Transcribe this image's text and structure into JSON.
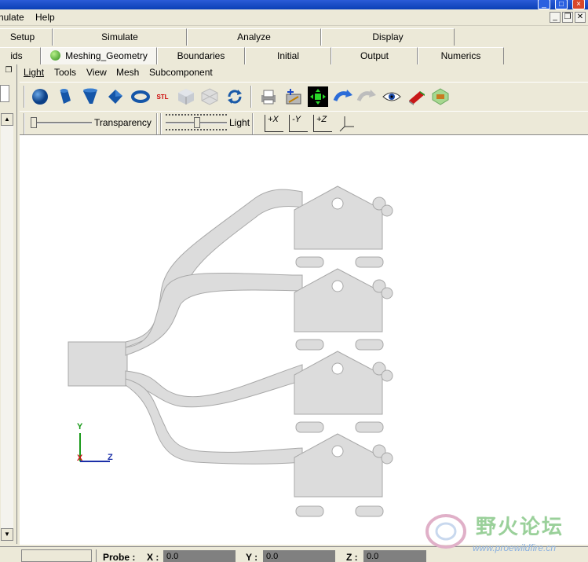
{
  "menubar": {
    "items": [
      "nulate",
      "Help"
    ]
  },
  "tabs_top": [
    "Setup",
    "Simulate",
    "Analyze",
    "Display"
  ],
  "tabs_sub": [
    "ids",
    "Meshing_Geometry",
    "Boundaries",
    "Initial",
    "Output",
    "Numerics"
  ],
  "main_menu": [
    "Light",
    "Tools",
    "View",
    "Mesh",
    "Subcomponent"
  ],
  "toolbar": {
    "stl_label": "STL",
    "tools": [
      "sphere-icon",
      "cylinder-icon",
      "cone-icon",
      "block-icon",
      "torus-icon",
      "stl-import-icon",
      "shaded-cube-icon",
      "wire-cube-icon",
      "refresh-icon",
      "print-icon",
      "capture-icon",
      "fit-view-icon",
      "rotate-icon",
      "rotate-disabled-icon",
      "eye-icon",
      "book-red-icon",
      "book-green-icon"
    ]
  },
  "view_toolbar": {
    "transparency_label": "Transparency",
    "light_label": "Light",
    "view_buttons": [
      "+X",
      "-Y",
      "+Z"
    ]
  },
  "axes": {
    "y_label": "Y",
    "x_label": "X",
    "z_label": "Z",
    "y_color": "#1a9a1a",
    "x_color": "#cc1111",
    "z_color": "#1b2fa8"
  },
  "status": {
    "probe_label": "Probe :",
    "x_label": "X :",
    "x_value": "0.0",
    "y_label": "Y :",
    "y_value": "0.0",
    "z_label": "Z :",
    "z_value": "0.0"
  },
  "watermark": {
    "cn_text": "野火论坛",
    "url": "www.proewildfire.cn"
  },
  "colors": {
    "window_bg": "#ece9d8",
    "part_fill": "#d9d9d9",
    "title_blue": "#0a3fb5"
  }
}
